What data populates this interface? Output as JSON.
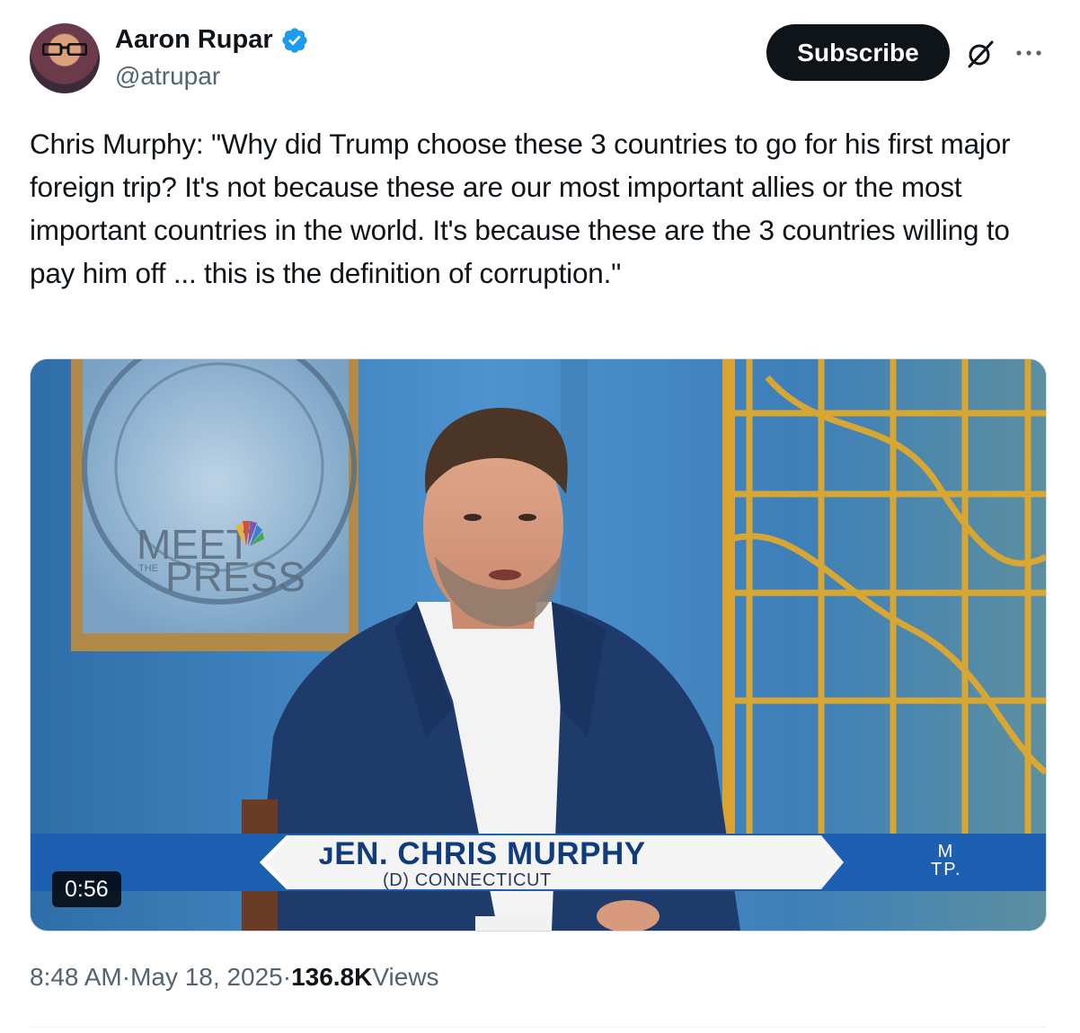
{
  "author": {
    "display_name": "Aaron Rupar",
    "handle": "@atrupar",
    "verified_icon": "verified-badge-icon",
    "verified_color": "#1d9bf0"
  },
  "actions": {
    "subscribe_label": "Subscribe",
    "grok_icon": "grok-icon",
    "more_icon": "more-options-icon"
  },
  "tweet": {
    "text": "Chris Murphy: \"Why did Trump choose these 3 countries to go for his first major foreign trip? It's not because these are our most important allies or the most important countries in the world. It's because these are the 3 countries willing to pay him off ... this is the definition of corruption.\""
  },
  "video": {
    "duration": "0:56",
    "set_logo_line1": "MEET",
    "set_logo_line2": "PRESS",
    "set_logo_small": "THE",
    "chyron_name": "ᴊEN. CHRIS MURPHY",
    "chyron_subtitle": "(D) CONNECTICUT",
    "corner_logo_top": "M",
    "corner_logo_bottom": "TP."
  },
  "meta": {
    "time": "8:48 AM",
    "separator": " · ",
    "date": "May 18, 2025",
    "views_count": "136.8K",
    "views_label": " Views"
  },
  "colors": {
    "text_primary": "#0f1419",
    "text_secondary": "#536471",
    "chyron_blue": "#1d5fb0"
  }
}
